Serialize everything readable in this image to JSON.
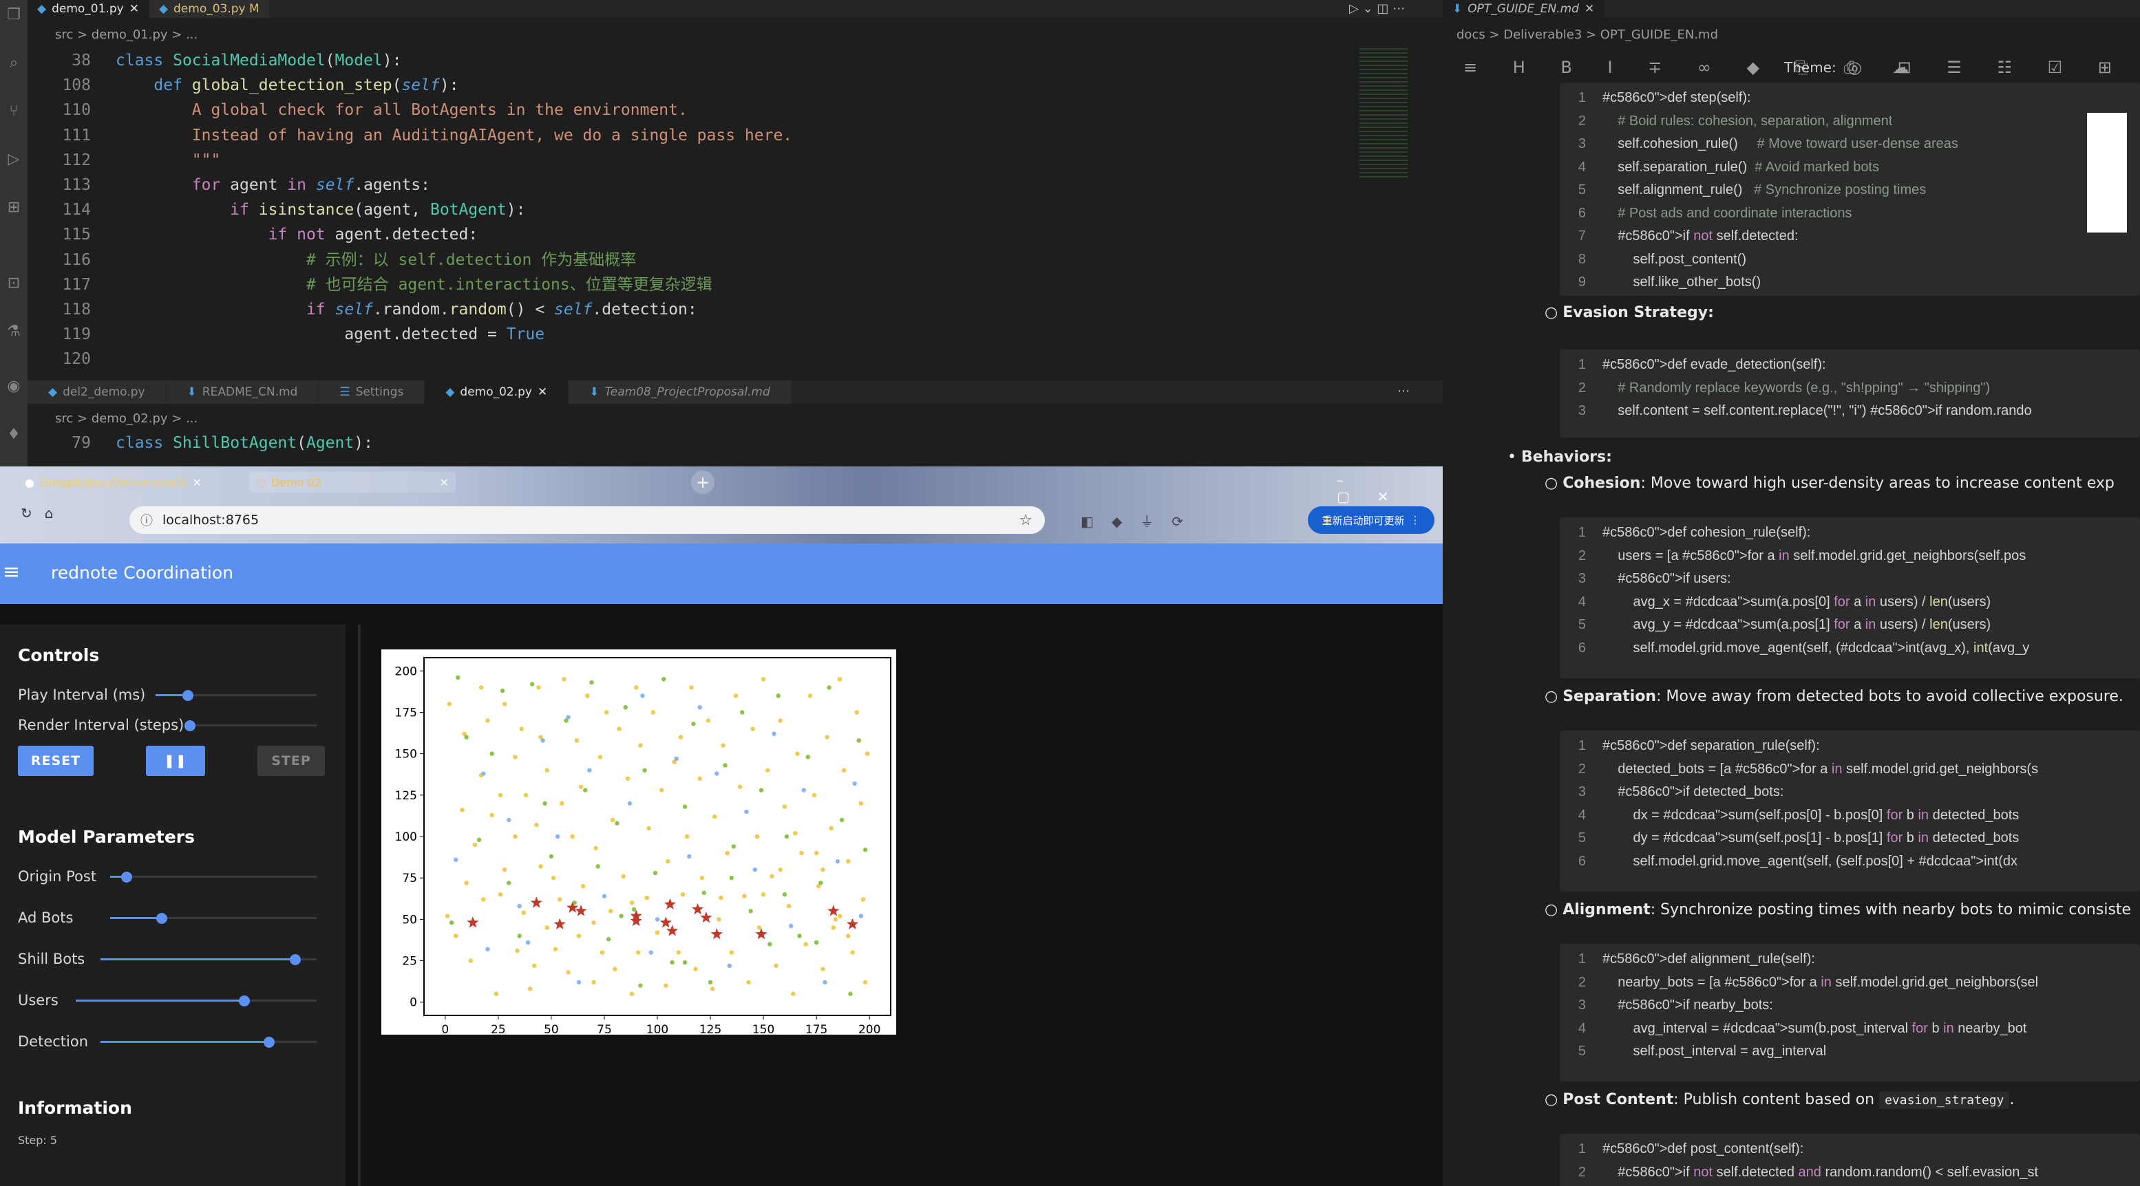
{
  "editor": {
    "tabs": [
      {
        "label": "demo_01.py",
        "active": true
      },
      {
        "label": "demo_03.py M",
        "active": false
      }
    ],
    "breadcrumb": "src  >  demo_01.py  >  ...",
    "lines": [
      {
        "n": "38",
        "html": "<span class='kw2'>class</span> <span class='cls'>SocialMediaModel</span>(<span class='cls'>Model</span>):"
      },
      {
        "n": "108",
        "html": "    <span class='kw2'>def</span> <span class='fn'>global_detection_step</span>(<span class='self'>self</span>):"
      },
      {
        "n": "110",
        "html": "        <span class='str'>A global check for all BotAgents in the environment.</span>"
      },
      {
        "n": "111",
        "html": "        <span class='str'>Instead of having an AuditingAIAgent, we do a single pass here.</span>"
      },
      {
        "n": "112",
        "html": "        <span class='str'>\"\"\"</span>"
      },
      {
        "n": "113",
        "html": "        <span class='kw'>for</span> agent <span class='kw'>in</span> <span class='self'>self</span>.agents:"
      },
      {
        "n": "114",
        "html": "            <span class='kw'>if</span> <span class='fn'>isinstance</span>(agent, <span class='cls'>BotAgent</span>):"
      },
      {
        "n": "115",
        "html": "                <span class='kw'>if not</span> agent.detected:"
      },
      {
        "n": "116",
        "html": "                    <span class='cm'># 示例：以 self.detection 作为基础概率</span>"
      },
      {
        "n": "117",
        "html": "                    <span class='cm'># 也可结合 agent.interactions、位置等更复杂逻辑</span>"
      },
      {
        "n": "118",
        "html": "                    <span class='kw'>if</span> <span class='self'>self</span>.random.<span class='fn'>random</span>() &lt; <span class='self'>self</span>.detection:"
      },
      {
        "n": "119",
        "html": "                        agent.detected = <span class='kw2'>True</span>"
      },
      {
        "n": "120",
        "html": ""
      }
    ],
    "tabs2": [
      {
        "label": "del2_demo.py",
        "active": false
      },
      {
        "label": "README_CN.md",
        "active": false
      },
      {
        "label": "Settings",
        "active": false
      },
      {
        "label": "demo_02.py",
        "active": true
      },
      {
        "label": "Team08_ProjectProposal.md",
        "active": false
      }
    ],
    "breadcrumb2": "src  >  demo_02.py  >  ...",
    "line2": {
      "n": "79",
      "html": "<span class='kw2'>class</span> <span class='cls'>ShillBotAgent</span>(<span class='cls'>Agent</span>):"
    }
  },
  "browser": {
    "tabs": [
      {
        "label": "Group8/docs/Deliverable3/"
      },
      {
        "label": "Demo 02"
      }
    ],
    "url": "localhost:8765",
    "profile_button": "重新启动即可更新",
    "app_title": "rednote Coordination",
    "controls_heading": "Controls",
    "play_interval_label": "Play Interval (ms)",
    "render_interval_label": "Render Interval (steps)",
    "play_interval_value": 0.2,
    "render_interval_value": 0.0,
    "reset_label": "RESET",
    "pause_label": "❚❚",
    "step_label": "STEP",
    "model_params_heading": "Model Parameters",
    "params": [
      {
        "label": "Origin Post",
        "value": 0.08
      },
      {
        "label": "Ad Bots",
        "value": 0.25
      },
      {
        "label": "Shill Bots",
        "value": 0.9
      },
      {
        "label": "Users",
        "value": 0.7
      },
      {
        "label": "Detection",
        "value": 0.78
      }
    ],
    "info_heading": "Information",
    "step_text": "Step: 5"
  },
  "chart_data": {
    "type": "scatter",
    "xlim": [
      -10,
      210
    ],
    "ylim": [
      -8,
      208
    ],
    "xticks": [
      "0",
      "25",
      "50",
      "75",
      "100",
      "125",
      "150",
      "175",
      "200"
    ],
    "yticks": [
      "0",
      "25",
      "50",
      "75",
      "100",
      "125",
      "150",
      "175",
      "200"
    ],
    "series": [
      {
        "marker": "star",
        "color": "#c0392b",
        "points": [
          [
            13,
            48
          ],
          [
            43,
            60
          ],
          [
            54,
            47
          ],
          [
            60,
            57
          ],
          [
            64,
            55
          ],
          [
            90,
            52
          ],
          [
            90,
            49
          ],
          [
            104,
            48
          ],
          [
            106,
            59
          ],
          [
            107,
            43
          ],
          [
            119,
            56
          ],
          [
            123,
            51
          ],
          [
            128,
            41
          ],
          [
            149,
            41
          ],
          [
            183,
            55
          ],
          [
            192,
            47
          ]
        ]
      },
      {
        "marker": "dot",
        "color": "#f2c94c",
        "points": [
          [
            1,
            52
          ],
          [
            2,
            180
          ],
          [
            5,
            40
          ],
          [
            8,
            116
          ],
          [
            9,
            162
          ],
          [
            10,
            72
          ],
          [
            12,
            25
          ],
          [
            14,
            95
          ],
          [
            17,
            190
          ],
          [
            17,
            137
          ],
          [
            18,
            62
          ],
          [
            20,
            170
          ],
          [
            22,
            113
          ],
          [
            24,
            5
          ],
          [
            26,
            125
          ],
          [
            26,
            65
          ],
          [
            28,
            80
          ],
          [
            28,
            180
          ],
          [
            33,
            148
          ],
          [
            33,
            100
          ],
          [
            34,
            31
          ],
          [
            36,
            165
          ],
          [
            37,
            54
          ],
          [
            38,
            125
          ],
          [
            40,
            8
          ],
          [
            42,
            22
          ],
          [
            43,
            107
          ],
          [
            44,
            190
          ],
          [
            45,
            160
          ],
          [
            45,
            82
          ],
          [
            48,
            45
          ],
          [
            48,
            140
          ],
          [
            51,
            75
          ],
          [
            52,
            32
          ],
          [
            54,
            62
          ],
          [
            55,
            120
          ],
          [
            56,
            195
          ],
          [
            58,
            18
          ],
          [
            60,
            100
          ],
          [
            62,
            158
          ],
          [
            63,
            40
          ],
          [
            64,
            130
          ],
          [
            65,
            70
          ],
          [
            67,
            185
          ],
          [
            70,
            12
          ],
          [
            71,
            93
          ],
          [
            73,
            148
          ],
          [
            74,
            30
          ],
          [
            76,
            175
          ],
          [
            78,
            55
          ],
          [
            79,
            110
          ],
          [
            80,
            20
          ],
          [
            82,
            165
          ],
          [
            84,
            76
          ],
          [
            86,
            135
          ],
          [
            88,
            5
          ],
          [
            90,
            190
          ],
          [
            91,
            30
          ],
          [
            92,
            155
          ],
          [
            95,
            63
          ],
          [
            96,
            105
          ],
          [
            98,
            175
          ],
          [
            100,
            42
          ],
          [
            102,
            128
          ],
          [
            104,
            10
          ],
          [
            105,
            85
          ],
          [
            108,
            145
          ],
          [
            110,
            30
          ],
          [
            111,
            160
          ],
          [
            112,
            65
          ],
          [
            114,
            100
          ],
          [
            116,
            190
          ],
          [
            118,
            20
          ],
          [
            120,
            135
          ],
          [
            121,
            75
          ],
          [
            124,
            170
          ],
          [
            126,
            8
          ],
          [
            127,
            112
          ],
          [
            129,
            50
          ],
          [
            131,
            155
          ],
          [
            133,
            90
          ],
          [
            135,
            30
          ],
          [
            137,
            185
          ],
          [
            139,
            130
          ],
          [
            141,
            64
          ],
          [
            143,
            12
          ],
          [
            145,
            165
          ],
          [
            147,
            100
          ],
          [
            148,
            45
          ],
          [
            150,
            195
          ],
          [
            152,
            140
          ],
          [
            154,
            76
          ],
          [
            156,
            22
          ],
          [
            158,
            170
          ],
          [
            160,
            118
          ],
          [
            162,
            58
          ],
          [
            164,
            5
          ],
          [
            166,
            150
          ],
          [
            168,
            90
          ],
          [
            170,
            35
          ],
          [
            172,
            185
          ],
          [
            174,
            125
          ],
          [
            176,
            70
          ],
          [
            178,
            20
          ],
          [
            180,
            160
          ],
          [
            182,
            105
          ],
          [
            184,
            50
          ],
          [
            186,
            195
          ],
          [
            188,
            140
          ],
          [
            190,
            85
          ],
          [
            192,
            30
          ],
          [
            194,
            175
          ],
          [
            196,
            120
          ],
          [
            197,
            62
          ],
          [
            198,
            12
          ],
          [
            199,
            150
          ],
          [
            88,
            60
          ],
          [
            70,
            48
          ],
          [
            130,
            63
          ],
          [
            150,
            65
          ],
          [
            175,
            90
          ],
          [
            178,
            80
          ],
          [
            183,
            45
          ],
          [
            186,
            52
          ],
          [
            190,
            40
          ],
          [
            165,
            102
          ],
          [
            158,
            80
          ]
        ]
      },
      {
        "marker": "dot",
        "color": "#8bc34a",
        "points": [
          [
            3,
            48
          ],
          [
            6,
            196
          ],
          [
            10,
            160
          ],
          [
            16,
            98
          ],
          [
            22,
            150
          ],
          [
            27,
            188
          ],
          [
            30,
            72
          ],
          [
            35,
            40
          ],
          [
            41,
            192
          ],
          [
            47,
            120
          ],
          [
            50,
            88
          ],
          [
            57,
            170
          ],
          [
            61,
            60
          ],
          [
            66,
            128
          ],
          [
            69,
            193
          ],
          [
            72,
            82
          ],
          [
            77,
            38
          ],
          [
            81,
            108
          ],
          [
            85,
            178
          ],
          [
            89,
            56
          ],
          [
            94,
            140
          ],
          [
            99,
            78
          ],
          [
            103,
            195
          ],
          [
            107,
            24
          ],
          [
            113,
            118
          ],
          [
            117,
            168
          ],
          [
            122,
            66
          ],
          [
            125,
            12
          ],
          [
            132,
            143
          ],
          [
            136,
            94
          ],
          [
            140,
            175
          ],
          [
            144,
            55
          ],
          [
            149,
            128
          ],
          [
            153,
            35
          ],
          [
            157,
            185
          ],
          [
            161,
            100
          ],
          [
            167,
            40
          ],
          [
            171,
            148
          ],
          [
            177,
            72
          ],
          [
            181,
            190
          ],
          [
            187,
            110
          ],
          [
            191,
            5
          ],
          [
            195,
            158
          ],
          [
            198,
            92
          ],
          [
            113,
            24
          ],
          [
            92,
            10
          ],
          [
            83,
            52
          ],
          [
            160,
            65
          ],
          [
            175,
            36
          ],
          [
            135,
            75
          ]
        ]
      },
      {
        "marker": "dot",
        "color": "#8ab4f8",
        "points": [
          [
            5,
            86
          ],
          [
            20,
            32
          ],
          [
            30,
            110
          ],
          [
            35,
            58
          ],
          [
            46,
            158
          ],
          [
            53,
            100
          ],
          [
            58,
            172
          ],
          [
            63,
            12
          ],
          [
            68,
            140
          ],
          [
            75,
            64
          ],
          [
            87,
            120
          ],
          [
            93,
            185
          ],
          [
            97,
            30
          ],
          [
            109,
            147
          ],
          [
            115,
            88
          ],
          [
            120,
            178
          ],
          [
            128,
            138
          ],
          [
            134,
            22
          ],
          [
            142,
            115
          ],
          [
            146,
            80
          ],
          [
            155,
            162
          ],
          [
            163,
            46
          ],
          [
            169,
            128
          ],
          [
            179,
            12
          ],
          [
            185,
            85
          ],
          [
            193,
            132
          ],
          [
            196,
            52
          ],
          [
            18,
            138
          ],
          [
            39,
            36
          ],
          [
            100,
            50
          ]
        ]
      }
    ]
  },
  "md": {
    "tab": "OPT_GUIDE_EN.md",
    "breadcrumb": "docs  >  Deliverable3  >  OPT_GUIDE_EN.md",
    "theme_label": "Theme:",
    "code1": [
      "def step(self):",
      "    # Boid rules: cohesion, separation, alignment",
      "    self.cohesion_rule()     # Move toward user-dense areas",
      "    self.separation_rule()  # Avoid marked bots",
      "    self.alignment_rule()   # Synchronize posting times",
      "    # Post ads and coordinate interactions",
      "    if not self.detected:",
      "        self.post_content()",
      "        self.like_other_bots()"
    ],
    "evasion_label": "Evasion Strategy:",
    "code2": [
      "def evade_detection(self):",
      "    # Randomly replace keywords (e.g., \"sh!pping\" → \"shipping\")",
      "    self.content = self.content.replace(\"!\", \"i\") if random.rando"
    ],
    "behaviors_label": "Behaviors:",
    "cohesion_title": "Cohesion",
    "cohesion_text": ": Move toward high user-density areas to increase content exp",
    "code3": [
      "def cohesion_rule(self):",
      "    users = [a for a in self.model.grid.get_neighbors(self.pos",
      "    if users:",
      "        avg_x = sum(a.pos[0] for a in users) / len(users)",
      "        avg_y = sum(a.pos[1] for a in users) / len(users)",
      "        self.model.grid.move_agent(self, (int(avg_x), int(avg_y"
    ],
    "separation_title": "Separation",
    "separation_text": ": Move away from detected bots to avoid collective exposure.",
    "code4": [
      "def separation_rule(self):",
      "    detected_bots = [a for a in self.model.grid.get_neighbors(s",
      "    if detected_bots:",
      "        dx = sum(self.pos[0] - b.pos[0] for b in detected_bots",
      "        dy = sum(self.pos[1] - b.pos[1] for b in detected_bots",
      "        self.model.grid.move_agent(self, (self.pos[0] + int(dx"
    ],
    "alignment_title": "Alignment",
    "alignment_text": ": Synchronize posting times with nearby bots to mimic consiste",
    "code5": [
      "def alignment_rule(self):",
      "    nearby_bots = [a for a in self.model.grid.get_neighbors(sel",
      "    if nearby_bots:",
      "        avg_interval = sum(b.post_interval for b in nearby_bot",
      "        self.post_interval = avg_interval"
    ],
    "post_title": "Post Content",
    "post_text": ": Publish content based on ",
    "post_code": "evasion_strategy",
    "code6": [
      "def post_content(self):",
      "    if not self.detected and random.random() < self.evasion_st"
    ]
  }
}
